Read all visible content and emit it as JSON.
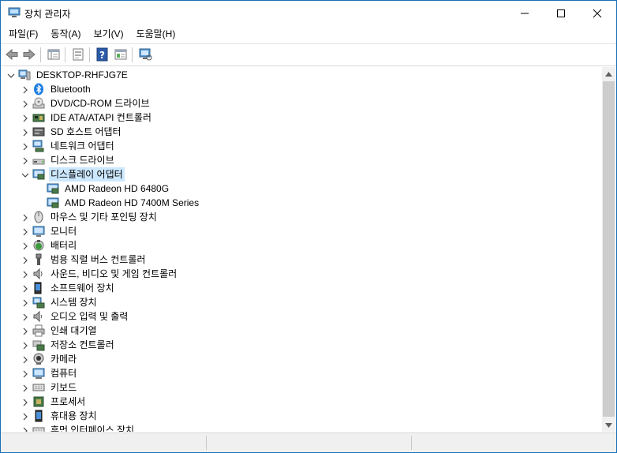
{
  "window": {
    "title": "장치 관리자"
  },
  "menu": [
    {
      "label": "파일(F)"
    },
    {
      "label": "동작(A)"
    },
    {
      "label": "보기(V)"
    },
    {
      "label": "도움말(H)"
    }
  ],
  "toolbar": [
    {
      "name": "back-arrow-icon"
    },
    {
      "name": "forward-arrow-icon"
    },
    {
      "name": "show-hide-tree-icon"
    },
    {
      "name": "properties-icon"
    },
    {
      "name": "help-icon"
    },
    {
      "name": "action-view-icon"
    },
    {
      "name": "monitor-scan-icon"
    }
  ],
  "tree": {
    "root": {
      "label": "DESKTOP-RHFJG7E",
      "expanded": true
    },
    "categories": [
      {
        "label": "Bluetooth",
        "icon": "bluetooth-icon",
        "expanded": false
      },
      {
        "label": "DVD/CD-ROM 드라이브",
        "icon": "dvd-drive-icon",
        "expanded": false
      },
      {
        "label": "IDE ATA/ATAPI 컨트롤러",
        "icon": "ide-controller-icon",
        "expanded": false
      },
      {
        "label": "SD 호스트 어댑터",
        "icon": "sd-host-icon",
        "expanded": false
      },
      {
        "label": "네트워크 어댑터",
        "icon": "network-adapter-icon",
        "expanded": false
      },
      {
        "label": "디스크 드라이브",
        "icon": "disk-drive-icon",
        "expanded": false
      },
      {
        "label": "디스플레이 어댑터",
        "icon": "display-adapter-icon",
        "expanded": true,
        "selected": true,
        "children": [
          {
            "label": "AMD Radeon HD 6480G",
            "icon": "display-adapter-icon"
          },
          {
            "label": "AMD Radeon HD 7400M Series",
            "icon": "display-adapter-icon"
          }
        ]
      },
      {
        "label": "마우스 및 기타 포인팅 장치",
        "icon": "mouse-icon",
        "expanded": false
      },
      {
        "label": "모니터",
        "icon": "monitor-icon",
        "expanded": false
      },
      {
        "label": "배터리",
        "icon": "battery-icon",
        "expanded": false
      },
      {
        "label": "범용 직렬 버스 컨트롤러",
        "icon": "usb-icon",
        "expanded": false
      },
      {
        "label": "사운드, 비디오 및 게임 컨트롤러",
        "icon": "speaker-icon",
        "expanded": false
      },
      {
        "label": "소프트웨어 장치",
        "icon": "software-device-icon",
        "expanded": false
      },
      {
        "label": "시스템 장치",
        "icon": "system-device-icon",
        "expanded": false
      },
      {
        "label": "오디오 입력 및 출력",
        "icon": "audio-io-icon",
        "expanded": false
      },
      {
        "label": "인쇄 대기열",
        "icon": "printer-icon",
        "expanded": false
      },
      {
        "label": "저장소 컨트롤러",
        "icon": "storage-controller-icon",
        "expanded": false
      },
      {
        "label": "카메라",
        "icon": "camera-icon",
        "expanded": false
      },
      {
        "label": "컴퓨터",
        "icon": "computer-icon",
        "expanded": false
      },
      {
        "label": "키보드",
        "icon": "keyboard-icon",
        "expanded": false
      },
      {
        "label": "프로세서",
        "icon": "processor-icon",
        "expanded": false
      },
      {
        "label": "휴대용 장치",
        "icon": "portable-device-icon",
        "expanded": false
      },
      {
        "label": "휴먼 인터페이스 장치",
        "icon": "hid-icon",
        "expanded": false
      }
    ]
  },
  "colors": {
    "selection": "#cce8ff",
    "accent": "#1a6fb5"
  }
}
